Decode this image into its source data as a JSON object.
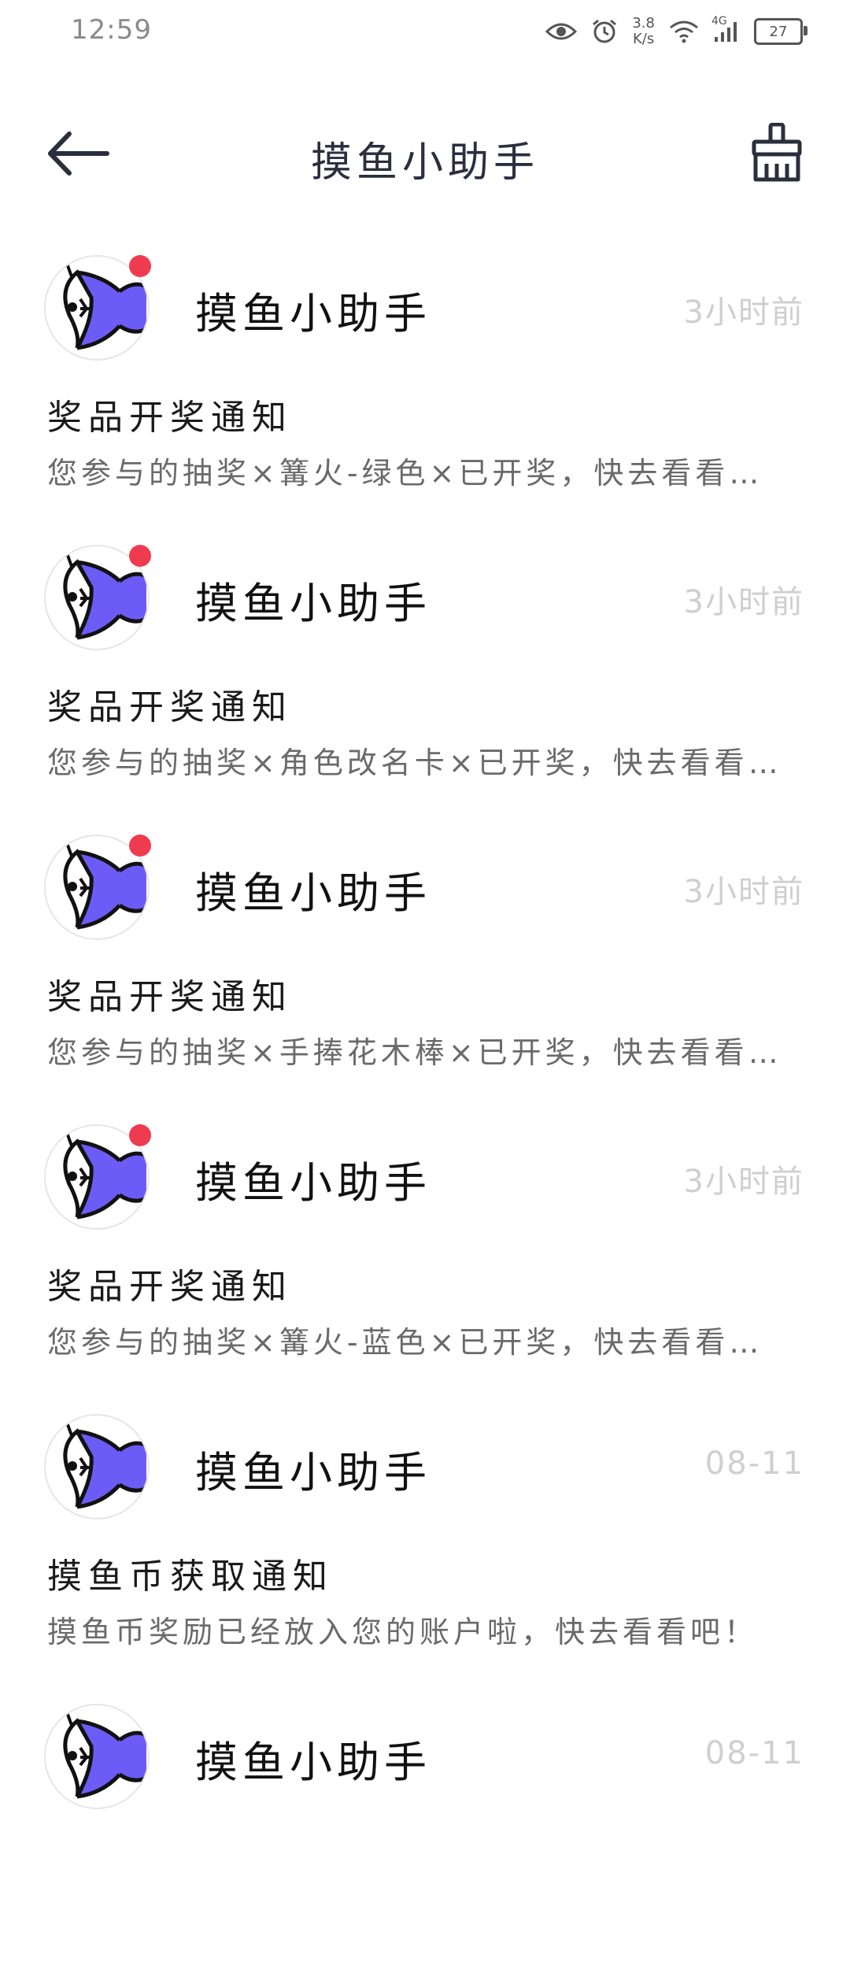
{
  "status_bar": {
    "time": "12:59",
    "net_speed_value": "3.8",
    "net_speed_unit": "K/s",
    "network_type": "4G",
    "battery": "27"
  },
  "header": {
    "title": "摸鱼小助手"
  },
  "colors": {
    "accent": "#6c5cf6",
    "unread": "#ef3b4f",
    "title": "#2a2f3d"
  },
  "messages": [
    {
      "sender": "摸鱼小助手",
      "time": "3小时前",
      "title": "奖品开奖通知",
      "body": "您参与的抽奖×篝火-绿色×已开奖，快去看看吧！",
      "unread": true
    },
    {
      "sender": "摸鱼小助手",
      "time": "3小时前",
      "title": "奖品开奖通知",
      "body": "您参与的抽奖×角色改名卡×已开奖，快去看看...",
      "unread": true
    },
    {
      "sender": "摸鱼小助手",
      "time": "3小时前",
      "title": "奖品开奖通知",
      "body": "您参与的抽奖×手捧花木棒×已开奖，快去看看...",
      "unread": true
    },
    {
      "sender": "摸鱼小助手",
      "time": "3小时前",
      "title": "奖品开奖通知",
      "body": "您参与的抽奖×篝火-蓝色×已开奖，快去看看吧！",
      "unread": true
    },
    {
      "sender": "摸鱼小助手",
      "time": "08-11",
      "title": "摸鱼币获取通知",
      "body": "摸鱼币奖励已经放入您的账户啦，快去看看吧！",
      "unread": false
    },
    {
      "sender": "摸鱼小助手",
      "time": "08-11",
      "title": "",
      "body": "",
      "unread": false
    }
  ]
}
